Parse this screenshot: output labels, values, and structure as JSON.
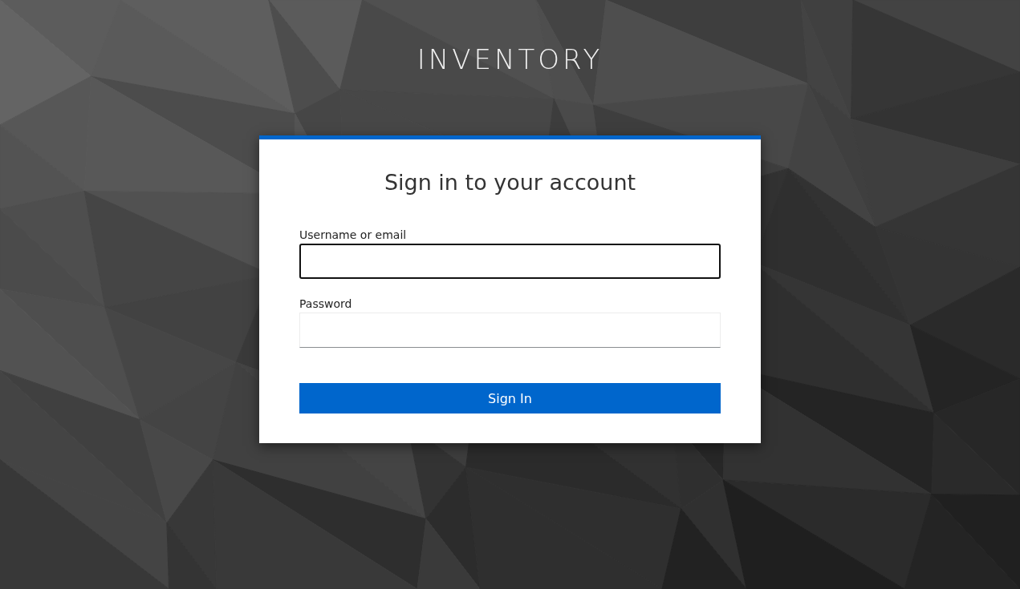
{
  "brand": "INVENTORY",
  "card": {
    "title": "Sign in to your account",
    "fields": [
      {
        "label": "Username or email",
        "focused": true
      },
      {
        "label": "Password",
        "focused": false
      }
    ],
    "submit": "Sign In"
  }
}
